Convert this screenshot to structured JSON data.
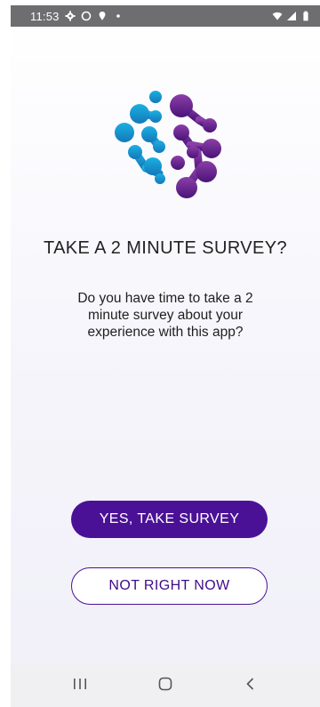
{
  "status_bar": {
    "time": "11:53",
    "left_icons": [
      "gear-icon",
      "circle-icon",
      "location-pin-icon",
      "dot-icon"
    ],
    "right_icons": [
      "wifi-icon",
      "signal-icon",
      "battery-icon"
    ],
    "background": "#6e6e71"
  },
  "survey": {
    "title": "TAKE A 2 MINUTE SURVEY?",
    "description": "Do you have time to take a 2 minute survey about your experience with this app?",
    "primary_button": "YES, TAKE SURVEY",
    "secondary_button": "NOT RIGHT NOW"
  },
  "colors": {
    "brand_purple": "#4a1196",
    "logo_blue": "#1a9bd7",
    "logo_purple": "#6b1e8f"
  },
  "nav_bar": {
    "icons": [
      "recent-apps-icon",
      "home-icon",
      "back-icon"
    ]
  }
}
